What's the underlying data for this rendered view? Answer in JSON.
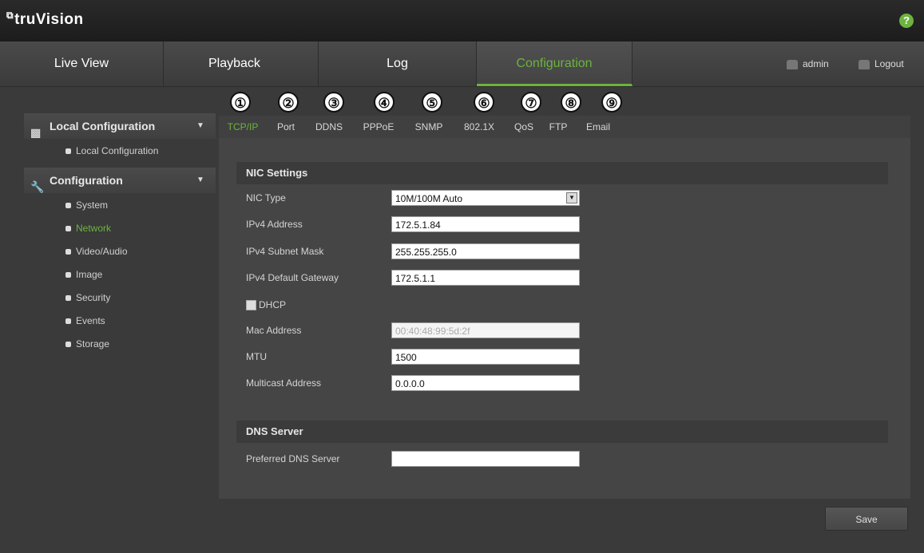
{
  "app": {
    "logo_mark": "⧉",
    "logo_text": "truVision",
    "help_glyph": "?"
  },
  "nav": {
    "tabs": [
      {
        "label": "Live View"
      },
      {
        "label": "Playback"
      },
      {
        "label": "Log"
      },
      {
        "label": "Configuration",
        "active": true
      }
    ],
    "user": "admin",
    "logout": "Logout"
  },
  "sidebar": {
    "sections": [
      {
        "label": "Local Configuration",
        "icon": "monitor-icon",
        "items": [
          "Local Configuration"
        ]
      },
      {
        "label": "Configuration",
        "icon": "wrench-icon",
        "items": [
          "System",
          "Network",
          "Video/Audio",
          "Image",
          "Security",
          "Events",
          "Storage"
        ],
        "active_item": "Network"
      }
    ]
  },
  "subtabs": {
    "items": [
      "TCP/IP",
      "Port",
      "DDNS",
      "PPPoE",
      "SNMP",
      "802.1X",
      "QoS",
      "FTP",
      "Email"
    ],
    "active": "TCP/IP",
    "callouts": [
      "①",
      "②",
      "③",
      "④",
      "⑤",
      "⑥",
      "⑦",
      "⑧",
      "⑨"
    ]
  },
  "nic": {
    "title": "NIC Settings",
    "nic_type_label": "NIC Type",
    "nic_type_value": "10M/100M Auto",
    "ipv4_label": "IPv4 Address",
    "ipv4_value": "172.5.1.84",
    "mask_label": "IPv4 Subnet Mask",
    "mask_value": "255.255.255.0",
    "gateway_label": "IPv4 Default Gateway",
    "gateway_value": "172.5.1.1",
    "dhcp_label": "DHCP",
    "dhcp_checked": false,
    "mac_label": "Mac Address",
    "mac_value": "00:40:48:99:5d:2f",
    "mtu_label": "MTU",
    "mtu_value": "1500",
    "multicast_label": "Multicast Address",
    "multicast_value": "0.0.0.0"
  },
  "dns": {
    "title": "DNS Server",
    "preferred_label": "Preferred DNS Server",
    "preferred_value": ""
  },
  "actions": {
    "save": "Save"
  },
  "colors": {
    "accent": "#6cb33f",
    "background": "#3a3a3a",
    "panel": "#454545"
  }
}
